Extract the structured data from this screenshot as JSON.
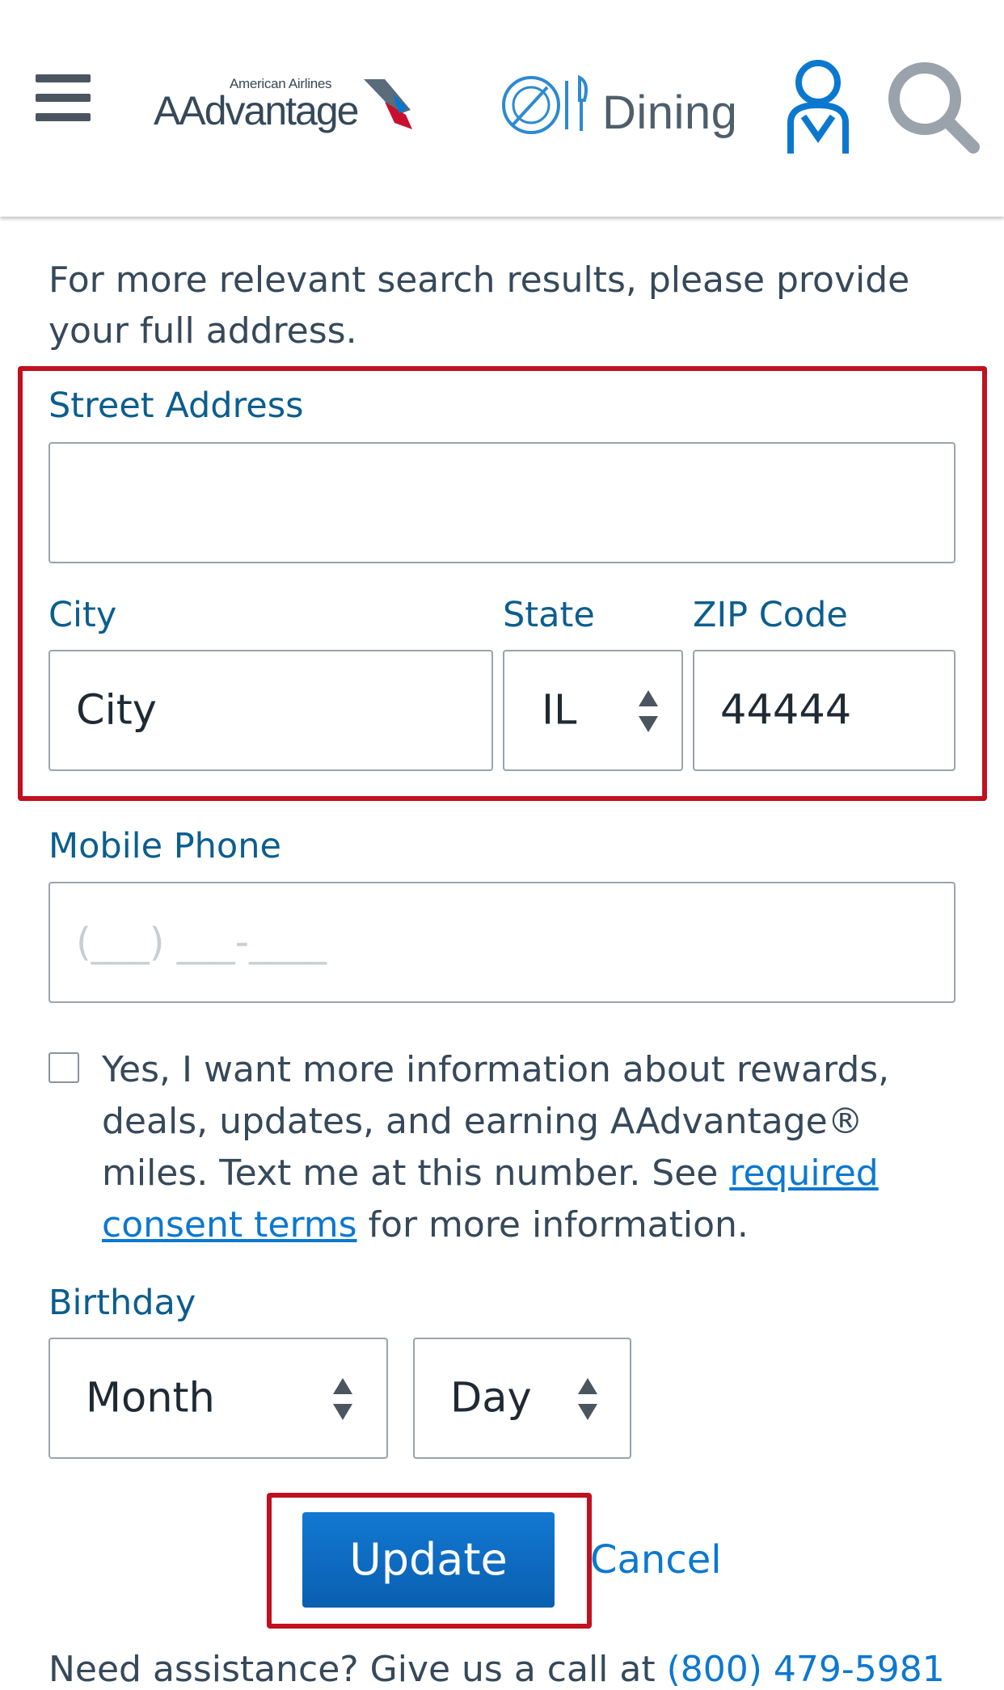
{
  "header": {
    "menu_icon": "hamburger-menu-icon",
    "brand_small": "American Airlines",
    "brand_name": "AAdvantage",
    "dining_label": "Dining",
    "profile_icon": "person-icon",
    "search_icon": "search-icon"
  },
  "intro": "For more relevant search results, please provide your full address.",
  "form": {
    "street_label": "Street Address",
    "street_value": "",
    "city_label": "City",
    "city_value": "City",
    "state_label": "State",
    "state_value": "IL",
    "zip_label": "ZIP Code",
    "zip_value": "44444",
    "mobile_label": "Mobile Phone",
    "mobile_placeholder": "(___) ___-____",
    "consent_text_1": "Yes, I want more information about rewards, deals, updates, and earning AAdvantage® miles. Text me at this number. See ",
    "consent_link": "required consent terms",
    "consent_text_2": " for more information.",
    "birthday_label": "Birthday",
    "month_value": "Month",
    "day_value": "Day"
  },
  "actions": {
    "update_label": "Update",
    "cancel_label": "Cancel"
  },
  "footer": {
    "text": "Need assistance? Give us a call at ",
    "phone": "(800) 479-5981"
  },
  "colors": {
    "label_blue": "#0b5e8e",
    "link_blue": "#0b78d0",
    "button_blue": "#0d6cc4",
    "highlight_red": "#c0111f"
  }
}
